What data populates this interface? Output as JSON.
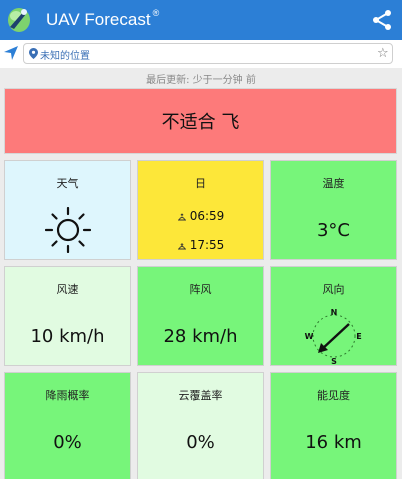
{
  "app": {
    "title": "UAV Forecast",
    "title_mark": "®"
  },
  "search": {
    "placeholder": "未知的位置"
  },
  "status": {
    "last_updated": "最后更新: 少于一分钟 前"
  },
  "verdict": {
    "text": "不适合 飞",
    "color": "#fd7a7a"
  },
  "tiles": {
    "weather": {
      "label": "天气",
      "icon": "sun-icon"
    },
    "sun": {
      "label": "日",
      "sunrise": "06:59",
      "sunset": "17:55"
    },
    "temperature": {
      "label": "温度",
      "value": "3°C"
    },
    "wind_speed": {
      "label": "风速",
      "value": "10 km/h"
    },
    "gusts": {
      "label": "阵风",
      "value": "28 km/h"
    },
    "wind_direction": {
      "label": "风向",
      "compass": {
        "n": "N",
        "e": "E",
        "s": "S",
        "w": "W"
      }
    },
    "precip": {
      "label": "降雨概率",
      "value": "0%"
    },
    "cloud": {
      "label": "云覆盖率",
      "value": "0%"
    },
    "visibility": {
      "label": "能见度",
      "value": "16 km"
    }
  },
  "colors": {
    "appbar": "#2c7fd6",
    "good": "#77f57a",
    "marginal": "#e1fbe1",
    "info": "#def6fd",
    "sun": "#fde739"
  }
}
